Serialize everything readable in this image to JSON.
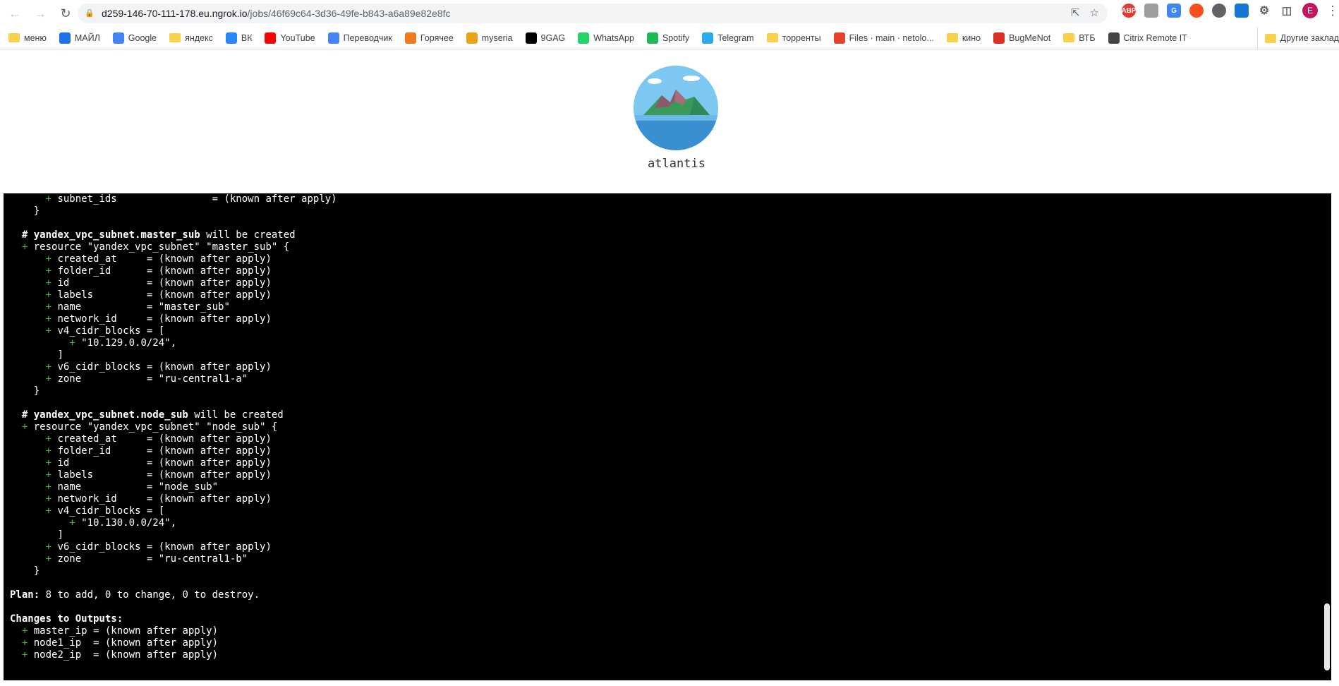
{
  "browser": {
    "url_host": "d259-146-70-111-178.eu.ngrok.io",
    "url_path": "/jobs/46f69c64-3d36-49fe-b843-a6a89e82e8fc",
    "profile_initial": "E",
    "ext_abp": "ABP"
  },
  "bookmarks": [
    {
      "label": "меню",
      "icon": "folder-icon",
      "color": "#f8d24a"
    },
    {
      "label": "МАЙЛ",
      "icon": "at-icon",
      "color": "#1a73e8"
    },
    {
      "label": "Google",
      "icon": "google-icon",
      "color": "#4285f4"
    },
    {
      "label": "яндекс",
      "icon": "folder-icon",
      "color": "#f8d24a"
    },
    {
      "label": "ВК",
      "icon": "vk-icon",
      "color": "#2787f5"
    },
    {
      "label": "YouTube",
      "icon": "youtube-icon",
      "color": "#ff0000"
    },
    {
      "label": "Переводчик",
      "icon": "translate-icon",
      "color": "#4285f4"
    },
    {
      "label": "Горячее",
      "icon": "pikabu-icon",
      "color": "#f27a1a"
    },
    {
      "label": "myseria",
      "icon": "myseria-icon",
      "color": "#e8a317"
    },
    {
      "label": "9GAG",
      "icon": "9gag-icon",
      "color": "#000000"
    },
    {
      "label": "WhatsApp",
      "icon": "whatsapp-icon",
      "color": "#25d366"
    },
    {
      "label": "Spotify",
      "icon": "spotify-icon",
      "color": "#1db954"
    },
    {
      "label": "Telegram",
      "icon": "telegram-icon",
      "color": "#2aabee"
    },
    {
      "label": "торренты",
      "icon": "folder-icon",
      "color": "#f8d24a"
    },
    {
      "label": "Files · main · netolo...",
      "icon": "gitlab-icon",
      "color": "#e24329"
    },
    {
      "label": "кино",
      "icon": "folder-icon",
      "color": "#f8d24a"
    },
    {
      "label": "BugMeNot",
      "icon": "bug-icon",
      "color": "#d93025"
    },
    {
      "label": "ВТБ",
      "icon": "folder-icon",
      "color": "#f8d24a"
    },
    {
      "label": "Citrix Remote IT",
      "icon": "citrix-icon",
      "color": "#444444"
    }
  ],
  "other_bookmarks": "Другие заклад",
  "app": {
    "title": "atlantis"
  },
  "terminal": {
    "lines": [
      {
        "ind": "      ",
        "plus": true,
        "text": " subnet_ids                = (known after apply)"
      },
      {
        "ind": "    ",
        "plus": false,
        "text": "}"
      },
      {
        "ind": "",
        "plus": false,
        "text": ""
      },
      {
        "ind": "  ",
        "plus": false,
        "bold": "# yandex_vpc_subnet.master_sub",
        "text": " will be created"
      },
      {
        "ind": "  ",
        "plus": true,
        "text": " resource \"yandex_vpc_subnet\" \"master_sub\" {"
      },
      {
        "ind": "      ",
        "plus": true,
        "text": " created_at     = (known after apply)"
      },
      {
        "ind": "      ",
        "plus": true,
        "text": " folder_id      = (known after apply)"
      },
      {
        "ind": "      ",
        "plus": true,
        "text": " id             = (known after apply)"
      },
      {
        "ind": "      ",
        "plus": true,
        "text": " labels         = (known after apply)"
      },
      {
        "ind": "      ",
        "plus": true,
        "text": " name           = \"master_sub\""
      },
      {
        "ind": "      ",
        "plus": true,
        "text": " network_id     = (known after apply)"
      },
      {
        "ind": "      ",
        "plus": true,
        "text": " v4_cidr_blocks = ["
      },
      {
        "ind": "          ",
        "plus": true,
        "text": " \"10.129.0.0/24\","
      },
      {
        "ind": "        ",
        "plus": false,
        "text": "]"
      },
      {
        "ind": "      ",
        "plus": true,
        "text": " v6_cidr_blocks = (known after apply)"
      },
      {
        "ind": "      ",
        "plus": true,
        "text": " zone           = \"ru-central1-a\""
      },
      {
        "ind": "    ",
        "plus": false,
        "text": "}"
      },
      {
        "ind": "",
        "plus": false,
        "text": ""
      },
      {
        "ind": "  ",
        "plus": false,
        "bold": "# yandex_vpc_subnet.node_sub",
        "text": " will be created"
      },
      {
        "ind": "  ",
        "plus": true,
        "text": " resource \"yandex_vpc_subnet\" \"node_sub\" {"
      },
      {
        "ind": "      ",
        "plus": true,
        "text": " created_at     = (known after apply)"
      },
      {
        "ind": "      ",
        "plus": true,
        "text": " folder_id      = (known after apply)"
      },
      {
        "ind": "      ",
        "plus": true,
        "text": " id             = (known after apply)"
      },
      {
        "ind": "      ",
        "plus": true,
        "text": " labels         = (known after apply)"
      },
      {
        "ind": "      ",
        "plus": true,
        "text": " name           = \"node_sub\""
      },
      {
        "ind": "      ",
        "plus": true,
        "text": " network_id     = (known after apply)"
      },
      {
        "ind": "      ",
        "plus": true,
        "text": " v4_cidr_blocks = ["
      },
      {
        "ind": "          ",
        "plus": true,
        "text": " \"10.130.0.0/24\","
      },
      {
        "ind": "        ",
        "plus": false,
        "text": "]"
      },
      {
        "ind": "      ",
        "plus": true,
        "text": " v6_cidr_blocks = (known after apply)"
      },
      {
        "ind": "      ",
        "plus": true,
        "text": " zone           = \"ru-central1-b\""
      },
      {
        "ind": "    ",
        "plus": false,
        "text": "}"
      },
      {
        "ind": "",
        "plus": false,
        "text": ""
      },
      {
        "ind": "",
        "plus": false,
        "bold": "Plan:",
        "text": " 8 to add, 0 to change, 0 to destroy."
      },
      {
        "ind": "",
        "plus": false,
        "text": ""
      },
      {
        "ind": "",
        "plus": false,
        "bold": "Changes to Outputs:",
        "text": ""
      },
      {
        "ind": "  ",
        "plus": true,
        "text": " master_ip = (known after apply)"
      },
      {
        "ind": "  ",
        "plus": true,
        "text": " node1_ip  = (known after apply)"
      },
      {
        "ind": "  ",
        "plus": true,
        "text": " node2_ip  = (known after apply)"
      }
    ]
  }
}
